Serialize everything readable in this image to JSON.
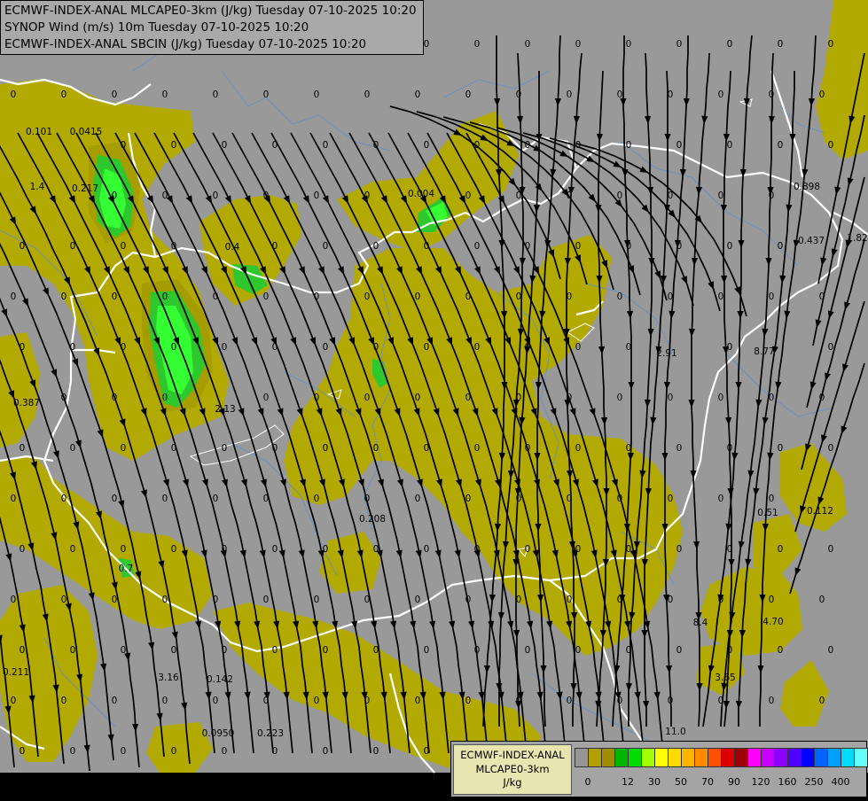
{
  "titles": {
    "line1": "ECMWF-INDEX-ANAL MLCAPE0-3km (J/kg) Tuesday 07-10-2025 10:20",
    "line2": "SYNOP Wind (m/s) 10m Tuesday 07-10-2025 10:20",
    "line3": "ECMWF-INDEX-ANAL SBCIN (J/kg) Tuesday 07-10-2025 10:20"
  },
  "legend": {
    "title_line1": "ECMWF-INDEX-ANAL",
    "title_line2": "MLCAPE0-3km",
    "units": "J/kg",
    "colors": [
      "#969696",
      "#b2a000",
      "#a08c00",
      "#00b400",
      "#00dc00",
      "#a0ff00",
      "#ffff00",
      "#ffdc00",
      "#ffb400",
      "#ff8c00",
      "#ff5000",
      "#dc0000",
      "#a00000",
      "#ff00ff",
      "#c800ff",
      "#8c00ff",
      "#5000ff",
      "#0000ff",
      "#0064ff",
      "#00a0ff",
      "#00dcff",
      "#64ffff",
      "#ffffff"
    ],
    "tick_labels": [
      "0",
      "12",
      "30",
      "50",
      "70",
      "90",
      "120",
      "160",
      "250",
      "400"
    ]
  },
  "map": {
    "colors": {
      "background": "#999999",
      "cape_low": "#b2aa00",
      "cape_mid": "#33cc33",
      "cape_high": "#33ff33",
      "borders": "#ffffff",
      "rivers": "#6699cc",
      "streamlines": "#000000"
    },
    "values": [
      "0",
      "0.101",
      "0.0415",
      "1.4",
      "0.217",
      "0.004",
      "0.4",
      "0.387",
      "2.13",
      "2.91",
      "8.77",
      "0.898",
      "0.437",
      "1.82",
      "0.208",
      "0.51",
      "0.112",
      "0.211",
      "3.16",
      "0.142",
      "0.0950",
      "0.223",
      "3.65",
      "4.70",
      "8.4",
      "11.0",
      "0.7"
    ]
  }
}
